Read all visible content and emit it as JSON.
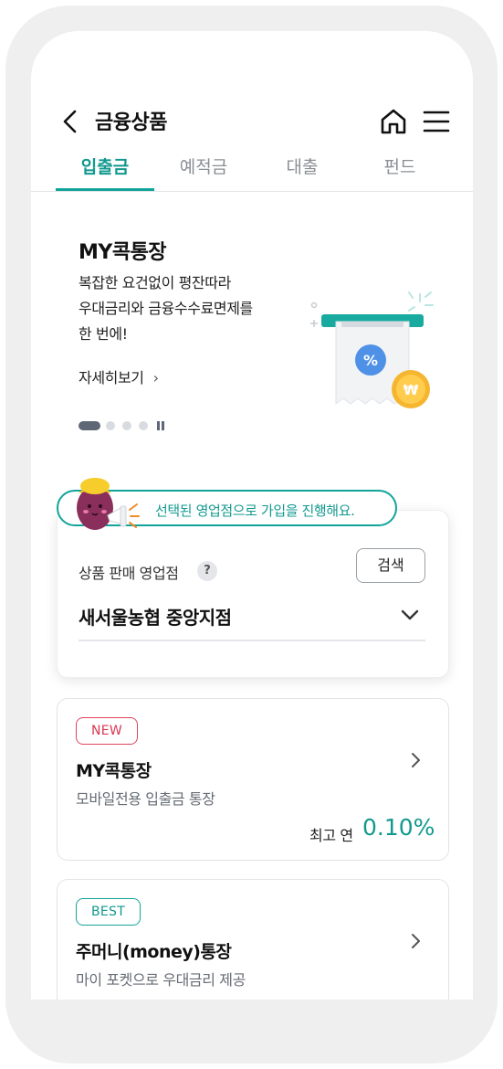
{
  "header": {
    "title": "금융상품",
    "back_icon": "chevron-left-icon",
    "home_icon": "home-icon",
    "menu_icon": "hamburger-menu-icon"
  },
  "tabs": [
    {
      "label": "입출금",
      "active": true
    },
    {
      "label": "예적금",
      "active": false
    },
    {
      "label": "대출",
      "active": false
    },
    {
      "label": "펀드",
      "active": false
    }
  ],
  "banner": {
    "title": "MY콕통장",
    "lines": [
      "복잡한 요건없이 평잔따라",
      "우대금리와 금융수수료면제를",
      "한 번에!"
    ],
    "more_label": "자세히보기",
    "pager": {
      "current": 1,
      "total": 4
    }
  },
  "branch": {
    "notice": "선택된 영업점으로 가입을 진행해요.",
    "label": "상품 판매 영업점",
    "help": "?",
    "search_label": "검색",
    "selected": "새서울농협 중앙지점"
  },
  "products": [
    {
      "badge": "NEW",
      "name": "MY콕통장",
      "desc": "모바일전용 입출금 통장",
      "rate_label": "최고 연",
      "rate": "0.10%"
    },
    {
      "badge": "BEST",
      "name": "주머니(money)통장",
      "desc": "마이 포켓으로 우대금리 제공"
    }
  ],
  "colors": {
    "accent": "#12a49a",
    "new_badge": "#e0435c",
    "pager_active": "#5d6776"
  }
}
